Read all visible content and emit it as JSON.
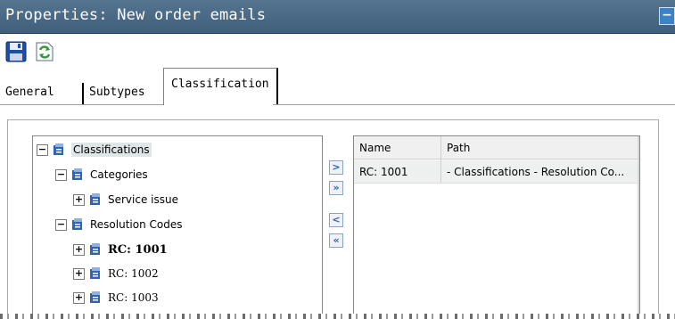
{
  "window": {
    "title": "Properties: New order emails",
    "control_icon": "minimize-icon"
  },
  "toolbar": {
    "buttons": [
      {
        "icon": "floppy-disk-icon",
        "action": "save"
      },
      {
        "icon": "refresh-icon",
        "action": "refresh"
      }
    ]
  },
  "tabs": [
    {
      "label": "General",
      "active": false
    },
    {
      "label": "Subtypes",
      "active": false
    },
    {
      "label": "Classification",
      "active": true
    }
  ],
  "tree": {
    "nodes": [
      {
        "label": "Classifications",
        "toggle": "−",
        "level": 0,
        "selected": true,
        "icon": "classification-db-icon"
      },
      {
        "label": "Categories",
        "toggle": "−",
        "level": 1,
        "icon": "classification-db-icon"
      },
      {
        "label": "Service issue",
        "toggle": "+",
        "level": 2,
        "icon": "classification-db-icon"
      },
      {
        "label": "Resolution Codes",
        "toggle": "−",
        "level": 1,
        "icon": "classification-db-icon"
      },
      {
        "label": "RC: 1001",
        "toggle": "+",
        "level": 2,
        "bold": true,
        "icon": "classification-db-icon"
      },
      {
        "label": "RC: 1002",
        "toggle": "+",
        "level": 2,
        "icon": "classification-db-icon"
      },
      {
        "label": "RC: 1003",
        "toggle": "+",
        "level": 2,
        "icon": "classification-db-icon"
      }
    ]
  },
  "transfer_buttons": [
    {
      "glyph": ">",
      "icon": "move-right-icon"
    },
    {
      "glyph": "»",
      "icon": "move-all-right-icon"
    },
    {
      "glyph": "<",
      "icon": "move-left-icon"
    },
    {
      "glyph": "«",
      "icon": "move-all-left-icon"
    }
  ],
  "grid": {
    "columns": [
      "Name",
      "Path"
    ],
    "rows": [
      {
        "name": "RC: 1001",
        "path": "- Classifications - Resolution Co..."
      }
    ]
  },
  "colors": {
    "titlebar": "#4a6a87",
    "selection": "#dfe6e8",
    "arrow_accent": "#2a63b5"
  }
}
